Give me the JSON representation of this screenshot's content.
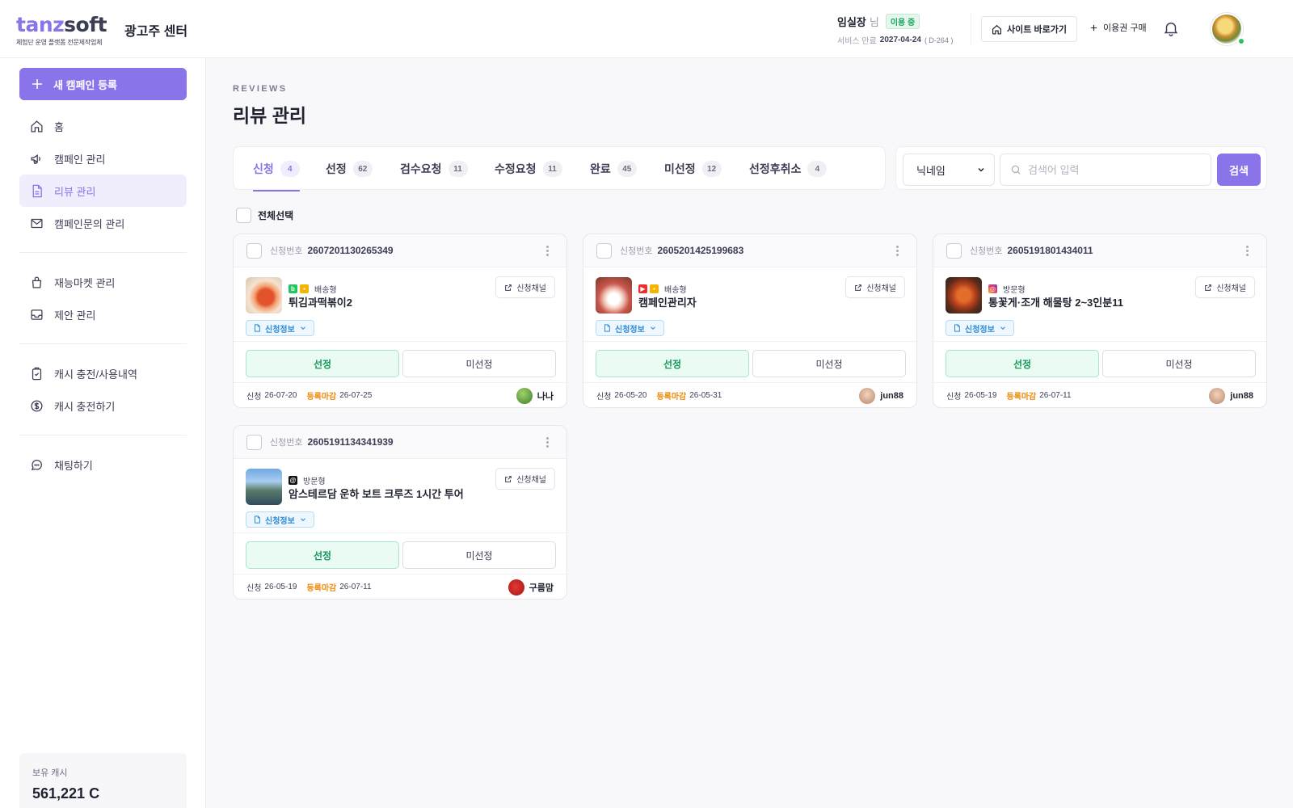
{
  "header": {
    "logo_main_a": "tanz",
    "logo_main_b": "soft",
    "logo_sub": "체험단 운영 플랫폼 전문제작업체",
    "center_name": "광고주 센터",
    "user_name": "임실장",
    "user_suffix": "님",
    "status": "이용 중",
    "service_label": "서비스 만료",
    "service_date": "2027-04-24",
    "dday": "( D-264 )",
    "site_button": "사이트 바로가기",
    "buy_button": "이용권 구매"
  },
  "sidebar": {
    "new_campaign": "새 캠페인 등록",
    "items": [
      {
        "label": "홈",
        "icon": "home-icon"
      },
      {
        "label": "캠페인 관리",
        "icon": "megaphone-icon"
      },
      {
        "label": "리뷰 관리",
        "icon": "document-icon"
      },
      {
        "label": "캠페인문의 관리",
        "icon": "mail-icon"
      },
      {
        "label": "재능마켓 관리",
        "icon": "bag-icon"
      },
      {
        "label": "제안 관리",
        "icon": "inbox-icon"
      },
      {
        "label": "캐시 충전/사용내역",
        "icon": "clipboard-icon"
      },
      {
        "label": "캐시 충전하기",
        "icon": "dollar-icon"
      },
      {
        "label": "채팅하기",
        "icon": "chat-icon"
      }
    ],
    "active_item": "리뷰 관리",
    "cash_label": "보유 캐시",
    "cash_value": "561,221 C"
  },
  "page": {
    "eyebrow": "REVIEWS",
    "title": "리뷰 관리"
  },
  "tabs": [
    {
      "label": "신청",
      "count": "4"
    },
    {
      "label": "선정",
      "count": "62"
    },
    {
      "label": "검수요청",
      "count": "11"
    },
    {
      "label": "수정요청",
      "count": "11"
    },
    {
      "label": "완료",
      "count": "45"
    },
    {
      "label": "미선정",
      "count": "12"
    },
    {
      "label": "선정후취소",
      "count": "4"
    }
  ],
  "search": {
    "filter_selected": "닉네임",
    "placeholder": "검색어 입력",
    "button": "검색"
  },
  "select_all": "전체선택",
  "card_labels": {
    "app_no_label": "신청번호",
    "channel_button": "신청채널",
    "info_chip": "신청정보",
    "select_button": "선정",
    "reject_button": "미선정",
    "applied_label": "신청",
    "deadline_label": "등록마감"
  },
  "cards": [
    {
      "app_no": "2607201130265349",
      "type": "배송형",
      "title": "튀김과떡볶이2",
      "applied": "26-07-20",
      "deadline": "26-07-25",
      "reviewer": "나나",
      "channels": [
        "blog-icon",
        "place-icon"
      ]
    },
    {
      "app_no": "2605201425199683",
      "type": "배송형",
      "title": "캠페인관리자",
      "applied": "26-05-20",
      "deadline": "26-05-31",
      "reviewer": "jun88",
      "channels": [
        "youtube-icon",
        "place-icon"
      ]
    },
    {
      "app_no": "2605191801434011",
      "type": "방문형",
      "title": "통꽃게·조개 해물탕 2~3인분11",
      "applied": "26-05-19",
      "deadline": "26-07-11",
      "reviewer": "jun88",
      "channels": [
        "instagram-icon"
      ]
    },
    {
      "app_no": "2605191134341939",
      "type": "방문형",
      "title": "암스테르담 운하 보트 크루즈 1시간 투어",
      "applied": "26-05-19",
      "deadline": "26-07-11",
      "reviewer": "구름맘",
      "channels": [
        "threads-icon"
      ]
    }
  ],
  "colors": {
    "accent": "#8b73ea",
    "success": "#17965a",
    "deadline": "#f08a0c",
    "info": "#2c8ad6"
  }
}
